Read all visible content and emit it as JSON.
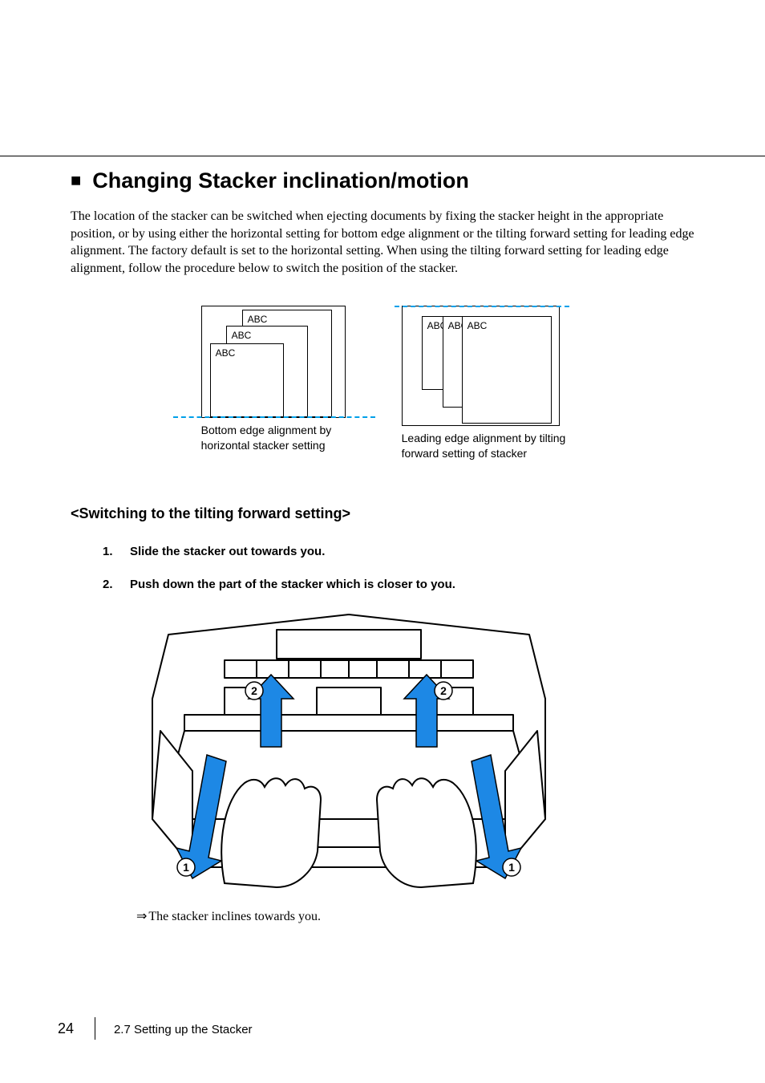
{
  "heading": "Changing Stacker inclination/motion",
  "intro": "The location of the stacker can be switched when ejecting documents by fixing the stacker height in the appropriate position, or by using either the horizontal setting for bottom edge alignment or the tilting forward setting for leading edge alignment. The factory default is set to the horizontal setting. When using the tilting forward setting for leading edge alignment, follow the procedure below to switch the position of the stacker.",
  "figA": {
    "labels": [
      "ABC",
      "ABC",
      "ABC"
    ],
    "caption_l1": "Bottom edge alignment by",
    "caption_l2": "horizontal stacker setting"
  },
  "figB": {
    "labels": [
      "ABC",
      "ABC",
      "ABC"
    ],
    "caption_l1": "Leading edge alignment by tilting",
    "caption_l2": "forward setting of stacker"
  },
  "subheading": "<Switching to the tilting forward setting>",
  "steps": [
    {
      "num": "1.",
      "text": "Slide the stacker out towards you."
    },
    {
      "num": "2.",
      "text": "Push down the part of the stacker which is closer to you."
    }
  ],
  "markers": {
    "one": "1",
    "two": "2"
  },
  "result_arrow": "⇒",
  "result_text": "The stacker inclines towards you.",
  "footer": {
    "page": "24",
    "section": "2.7 Setting up the Stacker"
  }
}
